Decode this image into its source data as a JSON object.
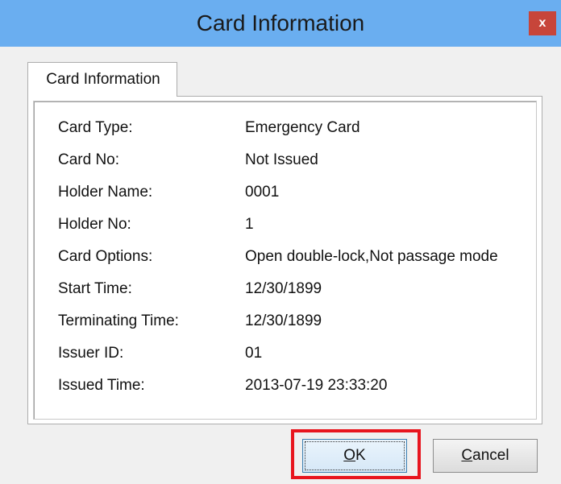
{
  "window": {
    "title": "Card Information",
    "close_glyph": "x",
    "titlebar_color": "#6aaef0",
    "close_color": "#c7453a"
  },
  "tabs": [
    {
      "label": "Card Information",
      "selected": true
    }
  ],
  "fields": [
    {
      "label": "Card Type:",
      "value": "Emergency Card"
    },
    {
      "label": "Card No:",
      "value": "Not Issued"
    },
    {
      "label": "Holder Name:",
      "value": "0001"
    },
    {
      "label": "Holder No:",
      "value": "1"
    },
    {
      "label": "Card Options:",
      "value": "Open double-lock,Not passage mode"
    },
    {
      "label": "Start Time:",
      "value": "12/30/1899"
    },
    {
      "label": "Terminating Time:",
      "value": "12/30/1899"
    },
    {
      "label": "Issuer ID:",
      "value": "01"
    },
    {
      "label": "Issued Time:",
      "value": "2013-07-19 23:33:20"
    }
  ],
  "buttons": {
    "ok": {
      "mnemonic": "O",
      "rest": "K",
      "focused": true
    },
    "cancel": {
      "mnemonic": "C",
      "rest": "ancel"
    }
  },
  "highlight_color": "#e8151e"
}
